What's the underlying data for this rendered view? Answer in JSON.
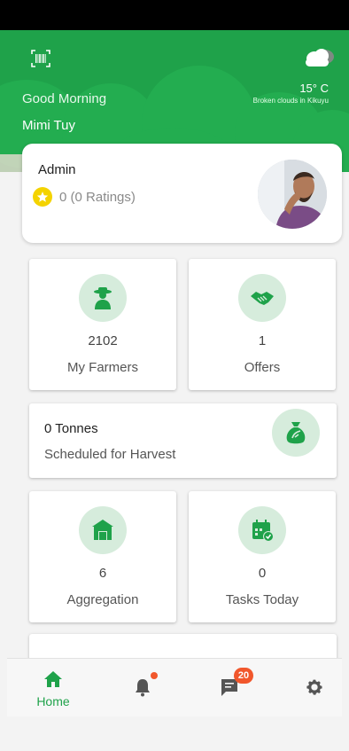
{
  "header": {
    "temperature": "15° C",
    "weather_desc": "Broken clouds in Kikuyu",
    "greeting": "Good Morning",
    "user_name": "Mimi Tuy",
    "icons": {
      "barcode": "barcode-scan-icon",
      "weather": "cloud-icon"
    }
  },
  "profile": {
    "role": "Admin",
    "rating_text": "0 (0 Ratings)",
    "icons": {
      "rating": "star-icon"
    }
  },
  "tiles": {
    "farmers": {
      "value": "2102",
      "label": "My Farmers",
      "icon": "farmer-icon"
    },
    "offers": {
      "value": "1",
      "label": "Offers",
      "icon": "handshake-icon"
    },
    "harvest": {
      "value": "0 Tonnes",
      "label": "Scheduled for Harvest",
      "icon": "money-bag-icon"
    },
    "aggregation": {
      "value": "6",
      "label": "Aggregation",
      "icon": "warehouse-icon"
    },
    "tasks": {
      "value": "0",
      "label": "Tasks Today",
      "icon": "calendar-check-icon"
    }
  },
  "bottom_nav": {
    "home_label": "Home",
    "chat_badge": "20",
    "icons": {
      "home": "home-icon",
      "notifications": "bell-icon",
      "messages": "message-icon",
      "settings": "gear-icon"
    }
  },
  "colors": {
    "brand_green": "#1fa24a",
    "icon_bg": "#d6ecdc",
    "badge": "#f1572c",
    "star": "#f4d300"
  }
}
